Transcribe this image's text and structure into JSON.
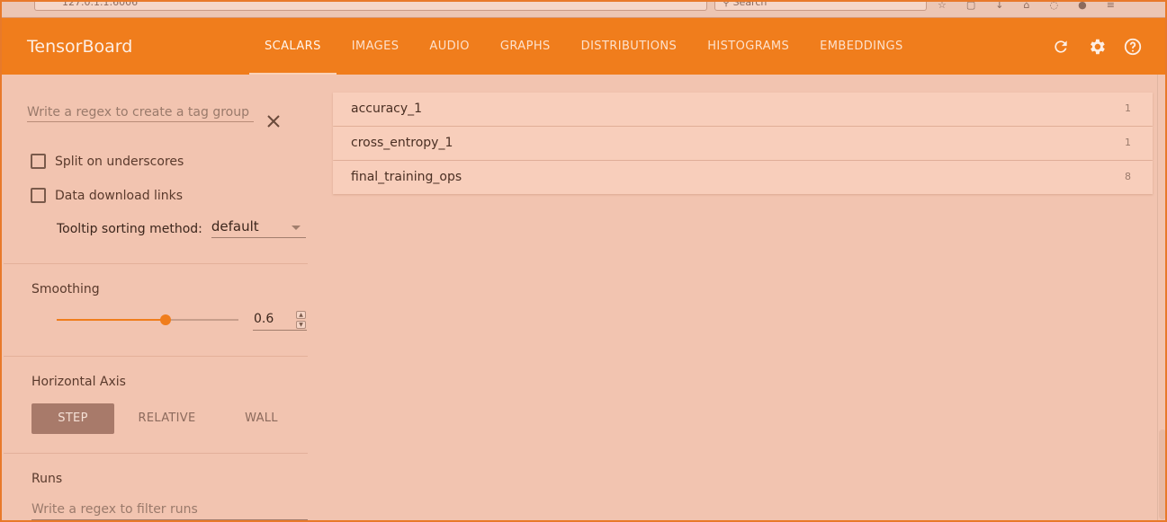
{
  "browser": {
    "url": "127.0.1.1:6006",
    "search_placeholder": "Search"
  },
  "header": {
    "brand": "TensorBoard",
    "tabs": [
      {
        "label": "SCALARS",
        "active": true
      },
      {
        "label": "IMAGES"
      },
      {
        "label": "AUDIO"
      },
      {
        "label": "GRAPHS"
      },
      {
        "label": "DISTRIBUTIONS"
      },
      {
        "label": "HISTOGRAMS"
      },
      {
        "label": "EMBEDDINGS"
      }
    ],
    "icons": [
      "refresh-icon",
      "settings-icon",
      "help-icon"
    ]
  },
  "sidebar": {
    "tag_regex_placeholder": "Write a regex to create a tag group",
    "split_label": "Split on underscores",
    "split_checked": false,
    "download_label": "Data download links",
    "download_checked": false,
    "tooltip_label": "Tooltip sorting method:",
    "tooltip_value": "default",
    "smoothing_title": "Smoothing",
    "smoothing_value": "0.6",
    "smoothing_fraction": 0.6,
    "axis_title": "Horizontal Axis",
    "axis_options": [
      "STEP",
      "RELATIVE",
      "WALL"
    ],
    "axis_selected": "STEP",
    "runs_title": "Runs",
    "runs_placeholder": "Write a regex to filter runs"
  },
  "main": {
    "items": [
      {
        "name": "accuracy_1",
        "count": "1"
      },
      {
        "name": "cross_entropy_1",
        "count": "1"
      },
      {
        "name": "final_training_ops",
        "count": "8"
      }
    ]
  },
  "colors": {
    "accent": "#f07d1c",
    "background": "#f2c4b0"
  }
}
